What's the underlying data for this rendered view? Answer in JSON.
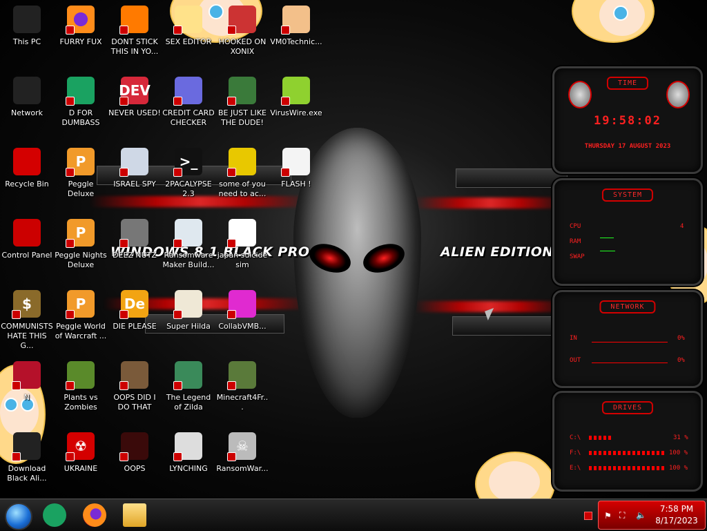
{
  "desktop_icons": [
    {
      "id": "this-pc",
      "label": "This PC"
    },
    {
      "id": "furry-fux",
      "label": "FURRY FUX"
    },
    {
      "id": "dont-stick",
      "label": "DONT STICK THIS IN YO..."
    },
    {
      "id": "sex-editor",
      "label": "SEX EDITOR"
    },
    {
      "id": "hooked-on-xonix",
      "label": "HOOKED ON XONIX"
    },
    {
      "id": "vm0technic",
      "label": "VM0Technic..."
    },
    {
      "id": "network",
      "label": "Network"
    },
    {
      "id": "d-for-dumbass",
      "label": "D FOR DUMBASS"
    },
    {
      "id": "never-used",
      "label": "NEVER USED!"
    },
    {
      "id": "credit-card-checker",
      "label": "CREDIT CARD CHECKER"
    },
    {
      "id": "be-just-like",
      "label": "BE JUST LIKE THE DUDE!"
    },
    {
      "id": "viruswire",
      "label": "VirusWire.exe"
    },
    {
      "id": "recycle-bin",
      "label": "Recycle Bin"
    },
    {
      "id": "peggle-deluxe",
      "label": "Peggle Deluxe"
    },
    {
      "id": "israel-spy",
      "label": "ISRAEL SPY"
    },
    {
      "id": "2pacalypse",
      "label": "2PACALYPSE 2.3"
    },
    {
      "id": "some-of-you",
      "label": "some of you need to ac..."
    },
    {
      "id": "flash",
      "label": "FLASH !"
    },
    {
      "id": "control-panel",
      "label": "Control Panel"
    },
    {
      "id": "peggle-nights",
      "label": "Peggle Nights Deluxe"
    },
    {
      "id": "deez-nutz",
      "label": "DEEZ NUTZ"
    },
    {
      "id": "ransomware-maker",
      "label": "Ransomware Maker Build..."
    },
    {
      "id": "japan-suicide-sim",
      "label": "japan suicide sim"
    },
    {
      "id": "communists",
      "label": "COMMUNISTS HATE THIS G..."
    },
    {
      "id": "peggle-world",
      "label": "Peggle World of Warcraft ..."
    },
    {
      "id": "die-please",
      "label": "DIE PLEASE"
    },
    {
      "id": "super-hilda",
      "label": "Super Hilda"
    },
    {
      "id": "collabvmb",
      "label": "CollabVMB..."
    },
    {
      "id": "n-icon",
      "label": "N"
    },
    {
      "id": "plants-vs-zombies",
      "label": "Plants vs Zombies"
    },
    {
      "id": "oops-did-i",
      "label": "OOPS DID I DO THAT"
    },
    {
      "id": "legend-of-zilda",
      "label": "The Legend of Zilda"
    },
    {
      "id": "minecraft4fr",
      "label": "Minecraft4Fr..."
    },
    {
      "id": "download-black-ali",
      "label": "Download Black Ali..."
    },
    {
      "id": "ukraine",
      "label": "UKRAINE"
    },
    {
      "id": "oops",
      "label": "OOPS"
    },
    {
      "id": "lynching",
      "label": "LYNCHING"
    },
    {
      "id": "ransomwar",
      "label": "RansomWar..."
    }
  ],
  "wallpaper": {
    "left_text": "WINDOWS 8.1 BLACK PRO",
    "right_text": "ALIEN EDITION 20"
  },
  "gadgets": {
    "time": {
      "title": "TIME",
      "clock": "19:58:02",
      "date": "THURSDAY 17 AUGUST 2023"
    },
    "system": {
      "title": "SYSTEM",
      "cpu_label": "CPU",
      "ram_label": "RAM",
      "swap_label": "SWAP",
      "cpu_value": "4"
    },
    "network": {
      "title": "NETWORK",
      "in_label": "IN",
      "out_label": "OUT",
      "in_value": "0%",
      "out_value": "0%"
    },
    "drives": {
      "title": "DRIVES",
      "d1_label": "C:\\",
      "d1_value": "31 %",
      "d2_label": "F:\\",
      "d2_value": "100 %",
      "d3_label": "E:\\",
      "d3_value": "100 %"
    }
  },
  "taskbar": {
    "apps": [
      {
        "id": "start",
        "name": "start-orb"
      },
      {
        "id": "sheets",
        "name": "sheets-icon"
      },
      {
        "id": "firefox",
        "name": "firefox-icon"
      },
      {
        "id": "explorer",
        "name": "file-explorer-icon"
      }
    ],
    "time": "7:58 PM",
    "date": "8/17/2023"
  },
  "colors": {
    "accent": "#d40000",
    "taskbar_tray": "#b00000"
  }
}
